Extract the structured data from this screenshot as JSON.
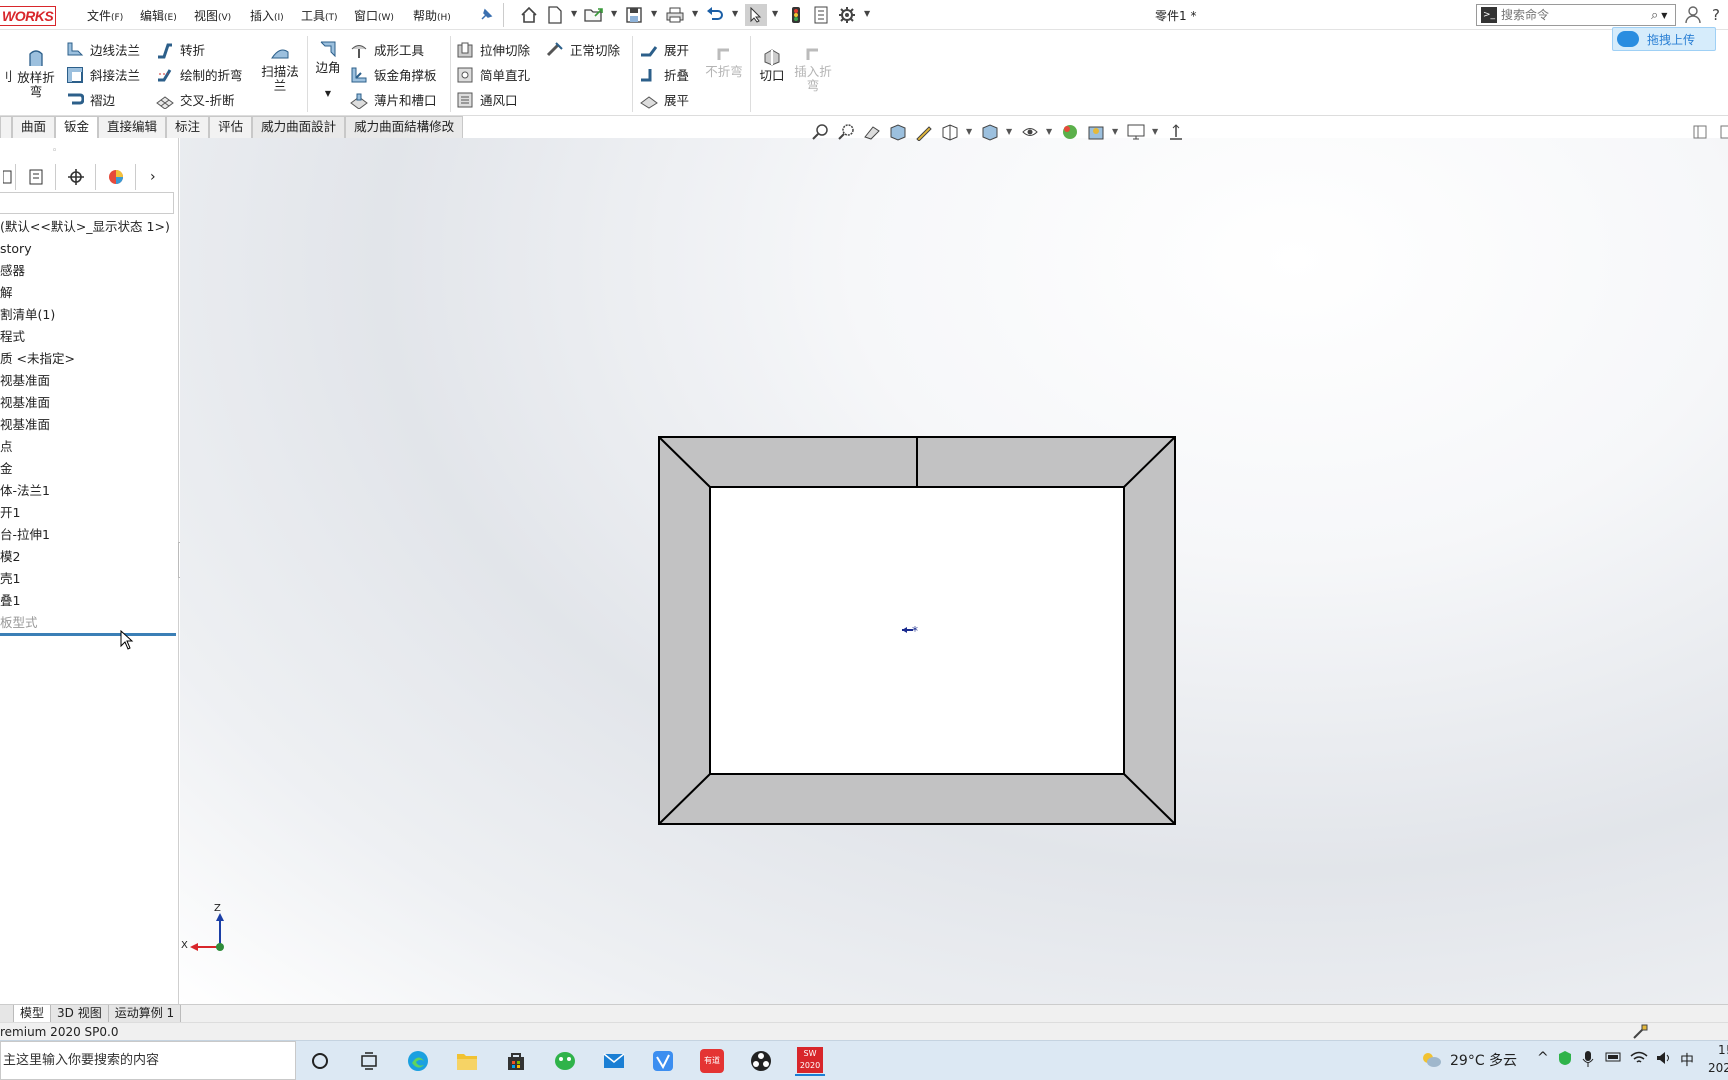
{
  "app": {
    "logo_text": "WORKS",
    "document_title": "零件1 *"
  },
  "menu": [
    {
      "label": "文件",
      "key": "(F)"
    },
    {
      "label": "编辑",
      "key": "(E)"
    },
    {
      "label": "视图",
      "key": "(V)"
    },
    {
      "label": "插入",
      "key": "(I)"
    },
    {
      "label": "工具",
      "key": "(T)"
    },
    {
      "label": "窗口",
      "key": "(W)"
    },
    {
      "label": "帮助",
      "key": "(H)"
    }
  ],
  "search": {
    "placeholder": "搜索命令"
  },
  "upload_button": "拖拽上传",
  "ribbon": {
    "cut_left": "刂",
    "lofted_bend": "放样折弯",
    "col1": [
      "边线法兰",
      "斜接法兰",
      "褶边"
    ],
    "col2": [
      "转折",
      "绘制的折弯",
      "交叉-折断"
    ],
    "swept_flange": "扫描法兰",
    "corner": "边角",
    "col3": [
      "成形工具",
      "钣金角撑板",
      "薄片和槽口"
    ],
    "col4": [
      "拉伸切除",
      "简单直孔",
      "通风口"
    ],
    "normal_cut": "正常切除",
    "col5": [
      "展开",
      "折叠",
      "展平"
    ],
    "no_bends": "不折弯",
    "rip": "切口",
    "insert_bends": "插入折弯"
  },
  "command_tabs": [
    "曲面",
    "钣金",
    "直接编辑",
    "标注",
    "评估",
    "威力曲面設計",
    "威力曲面結構修改"
  ],
  "active_command_tab": "钣金",
  "feature_tree": {
    "config_line": "(默认<<默认>_显示状态 1>)",
    "items": [
      "story",
      "感器",
      "解",
      "割清单(1)",
      "程式",
      "质 <未指定>",
      "视基准面",
      "视基准面",
      "视基准面",
      "点",
      "金",
      "体-法兰1",
      "开1",
      "台-拉伸1",
      "模2",
      "壳1",
      "叠1"
    ],
    "last_item": "板型式"
  },
  "triad": {
    "z_label": "Z",
    "x_label": "X"
  },
  "bottom_tabs": [
    "模型",
    "3D 视图",
    "运动算例 1"
  ],
  "status_text": "remium 2020 SP0.0",
  "taskbar": {
    "search_text": "主这里输入你要搜索的内容",
    "weather": "29°C 多云",
    "ime": "中",
    "time": "1!",
    "date": "202",
    "sw_badge": "SW 2020",
    "app_red_label": "有道"
  },
  "colors": {
    "accent": "#d8262b",
    "part_face": "#c2c2c3",
    "taskbar": "#dce8f3"
  }
}
